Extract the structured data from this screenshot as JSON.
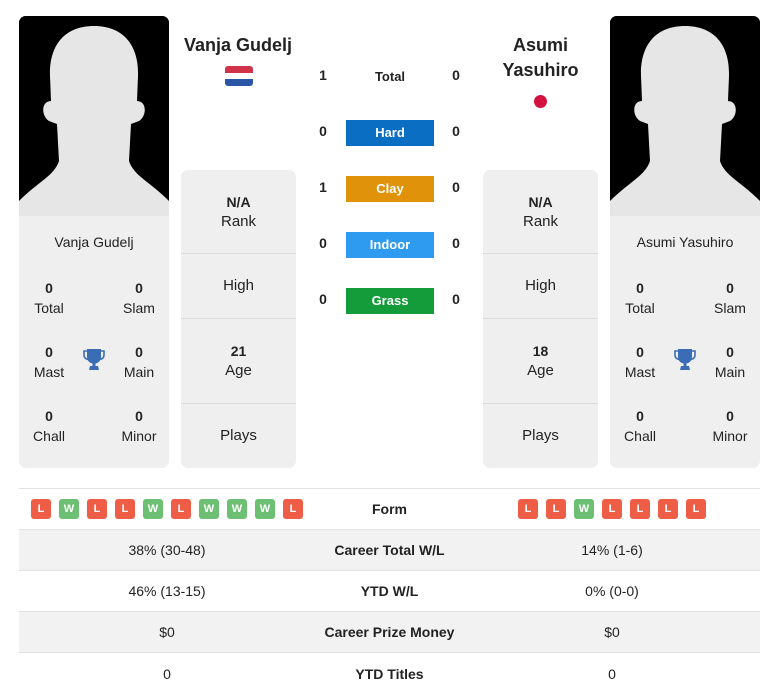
{
  "colors": {
    "hard": "#0a6ec2",
    "clay": "#e0920b",
    "indoor": "#2e9bf0",
    "grass": "#159c3a",
    "win": "#6dbf73",
    "loss": "#ee5e47",
    "trophy": "#3a6db5",
    "nl_red": "#d0334a",
    "nl_white": "#ffffff",
    "nl_blue": "#2b56a5",
    "jp_red": "#d3123f"
  },
  "player1": {
    "name": "Vanja Gudelj",
    "card_name": "Vanja Gudelj",
    "flag": "netherlands-flag",
    "titles": {
      "total": {
        "value": "0",
        "label": "Total"
      },
      "slam": {
        "value": "0",
        "label": "Slam"
      },
      "mast": {
        "value": "0",
        "label": "Mast"
      },
      "main": {
        "value": "0",
        "label": "Main"
      },
      "chall": {
        "value": "0",
        "label": "Chall"
      },
      "minor": {
        "value": "0",
        "label": "Minor"
      }
    },
    "info": {
      "rank_value": "N/A",
      "rank_label": "Rank",
      "high_label": "High",
      "age_value": "21",
      "age_label": "Age",
      "plays_label": "Plays"
    }
  },
  "player2": {
    "name_line1": "Asumi",
    "name_line2": "Yasuhiro",
    "card_name": "Asumi Yasuhiro",
    "flag": "japan-flag",
    "titles": {
      "total": {
        "value": "0",
        "label": "Total"
      },
      "slam": {
        "value": "0",
        "label": "Slam"
      },
      "mast": {
        "value": "0",
        "label": "Mast"
      },
      "main": {
        "value": "0",
        "label": "Main"
      },
      "chall": {
        "value": "0",
        "label": "Chall"
      },
      "minor": {
        "value": "0",
        "label": "Minor"
      }
    },
    "info": {
      "rank_value": "N/A",
      "rank_label": "Rank",
      "high_label": "High",
      "age_value": "18",
      "age_label": "Age",
      "plays_label": "Plays"
    }
  },
  "h2h": {
    "total": {
      "label": "Total",
      "p1": "1",
      "p2": "0"
    },
    "surfaces": [
      {
        "label": "Hard",
        "p1": "0",
        "p2": "0"
      },
      {
        "label": "Clay",
        "p1": "1",
        "p2": "0"
      },
      {
        "label": "Indoor",
        "p1": "0",
        "p2": "0"
      },
      {
        "label": "Grass",
        "p1": "0",
        "p2": "0"
      }
    ]
  },
  "table": {
    "form": {
      "label": "Form",
      "p1": [
        "L",
        "W",
        "L",
        "L",
        "W",
        "L",
        "W",
        "W",
        "W",
        "L"
      ],
      "p2": [
        "L",
        "L",
        "W",
        "L",
        "L",
        "L",
        "L"
      ]
    },
    "rows": [
      {
        "label": "Career Total W/L",
        "p1": "38% (30-48)",
        "p2": "14% (1-6)"
      },
      {
        "label": "YTD W/L",
        "p1": "46% (13-15)",
        "p2": "0% (0-0)"
      },
      {
        "label": "Career Prize Money",
        "p1": "$0",
        "p2": "$0"
      },
      {
        "label": "YTD Titles",
        "p1": "0",
        "p2": "0"
      }
    ]
  }
}
